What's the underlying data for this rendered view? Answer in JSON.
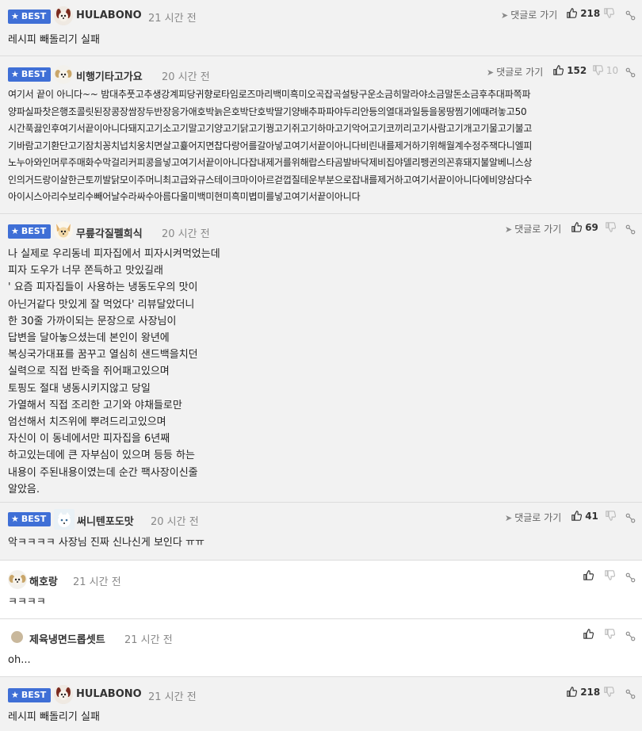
{
  "comments": [
    {
      "badge": "BEST",
      "nick": "HULABONO",
      "time": "21 시간 전",
      "reply": "댓글로 가기",
      "up": "218",
      "down": "",
      "text": "레시피 빼돌리기 실패"
    },
    {
      "badge": "BEST",
      "nick": "비행기타고가요",
      "time": "20 시간 전",
      "reply": "댓글로 가기",
      "up": "152",
      "down": "10",
      "text": "여기서 끝이 아니다~~ 밤대추풋고추생강계피당귀향로타임로즈마리백미흑미오곡잡곡설탕구운소금히말라야소금말돈소금후추대파쪽파\n양파실파찻은행조콜릿된장콩장쌈장두반장응가애호박늙은호박단호박딸기양배추파파야두리안등의열대과일등을몽땅찜기에때려놓고50\n시간푹끓인후여기서끝이아니다돼지고기소고기말고기양고기닭고기꿩고기쥐고기하마고기악어고기코끼리고기사람고기개고기물고기불고\n기바람고기환단고기잠치꽁치넙치웅치면살고흁어지면찹다랑어를갈아넣고여기서끝이아니다비린내를제거하기위해월계수정주잭다니엘피\n노누아와인머루주매화수막걸리커피콩을넣고여기서끝이아니다잡내제거를위해랍스타곰발바닥제비집야델리펭귄의꼰휴돼지불알베니스상\n인의거드랑이살한근토끼발닭모이주머니최고급와규스테이크마이아르걷껍질테운부분으로잡내를제거하고여기서끝이아니다에비양삼다수\n아이시스아리수보리수빼어날수라싸수아름다울미백미현미흑미볍미를넣고여기서끝이아니다"
    },
    {
      "badge": "BEST",
      "nick": "무릎각질펠희식",
      "time": "20 시간 전",
      "reply": "댓글로 가기",
      "up": "69",
      "down": "",
      "text": "나 실제로 우리동네 피자집에서 피자시켜먹었는데\n피자 도우가 너무 쫀득하고 맛있길래\n' 요즘 피자집들이 사용하는 냉동도우의 맛이\n아닌거같다 맛있게 잘 먹었다' 리뷰달았더니\n한 30줄 가까이되는 문장으로 사장님이\n답변을 달아놓으셨는데 본인이 왕년에\n복싱국가대표를 꿈꾸고 열심히 샌드백을치던\n실력으로 직접 반죽을 쥐어패고있으며\n토핑도 절대 냉동시키지않고 당일\n가열해서 직접 조리한 고기와 야채들로만\n엄선해서 치즈위에 뿌려드리고있으며\n자신이 이 동네에서만 피자집을 6년째\n하고있는데에 큰 자부심이 있으며 등등 하는\n내용이 주된내용이였는데 순간 팩사장이신줄\n알았음."
    },
    {
      "badge": "BEST",
      "nick": "써니텐포도맛",
      "time": "20 시간 전",
      "reply": "댓글로 가기",
      "up": "41",
      "down": "",
      "text": "악ㅋㅋㅋㅋ 사장님 진짜 신나신게 보인다 ㅠㅠ"
    },
    {
      "badge": "",
      "nick": "해호랑",
      "time": "21 시간 전",
      "reply": "",
      "up": "",
      "down": "",
      "text": "ㅋㅋㅋㅋ"
    },
    {
      "badge": "",
      "nick": "제육냉면드롭셋트",
      "time": "21 시간 전",
      "reply": "",
      "up": "",
      "down": "",
      "text": "oh..."
    },
    {
      "badge": "BEST",
      "nick": "HULABONO",
      "time": "21 시간 전",
      "reply": "",
      "up": "218",
      "down": "",
      "text": "레시피 빼돌리기 실패"
    }
  ]
}
